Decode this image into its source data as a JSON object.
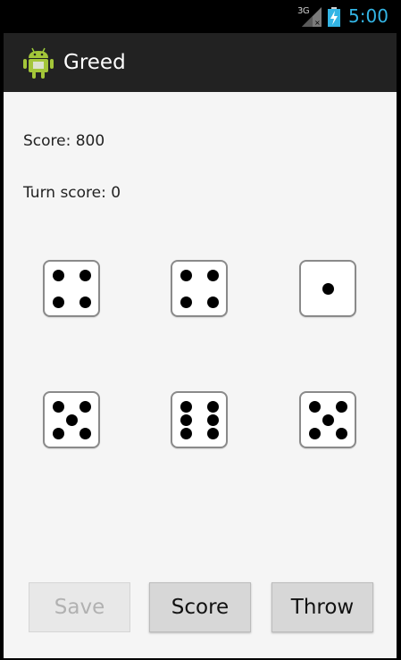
{
  "status_bar": {
    "network": "3G",
    "time": "5:00",
    "signal_icon": "signal-icon",
    "battery_icon": "battery-charging-icon",
    "accent_color": "#33b5e5"
  },
  "action_bar": {
    "title": "Greed",
    "logo_icon": "android-logo"
  },
  "game": {
    "score": "Score: 800",
    "turn_score": "Turn score: 0",
    "dice": [
      4,
      4,
      1,
      5,
      6,
      5
    ]
  },
  "buttons": {
    "save": "Save",
    "score": "Score",
    "throw": "Throw"
  }
}
